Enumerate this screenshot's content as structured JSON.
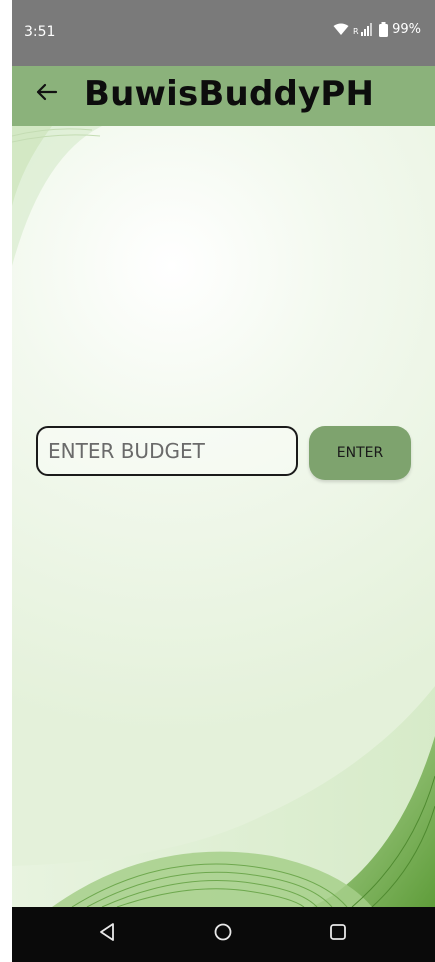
{
  "status_bar": {
    "time": "3:51",
    "battery_percent": "99%",
    "icons": [
      "wifi-icon",
      "signal-icon",
      "battery-icon"
    ]
  },
  "app_bar": {
    "title": "BuwisBuddyPH",
    "back_icon": "arrow-left-icon",
    "color": "#8bb27b"
  },
  "budget_form": {
    "placeholder": "ENTER BUDGET",
    "value": "",
    "button_label": "ENTER",
    "button_color": "#7ea36e"
  },
  "nav_bar": {
    "buttons": [
      "back-triangle-icon",
      "home-circle-icon",
      "recents-square-icon"
    ]
  }
}
